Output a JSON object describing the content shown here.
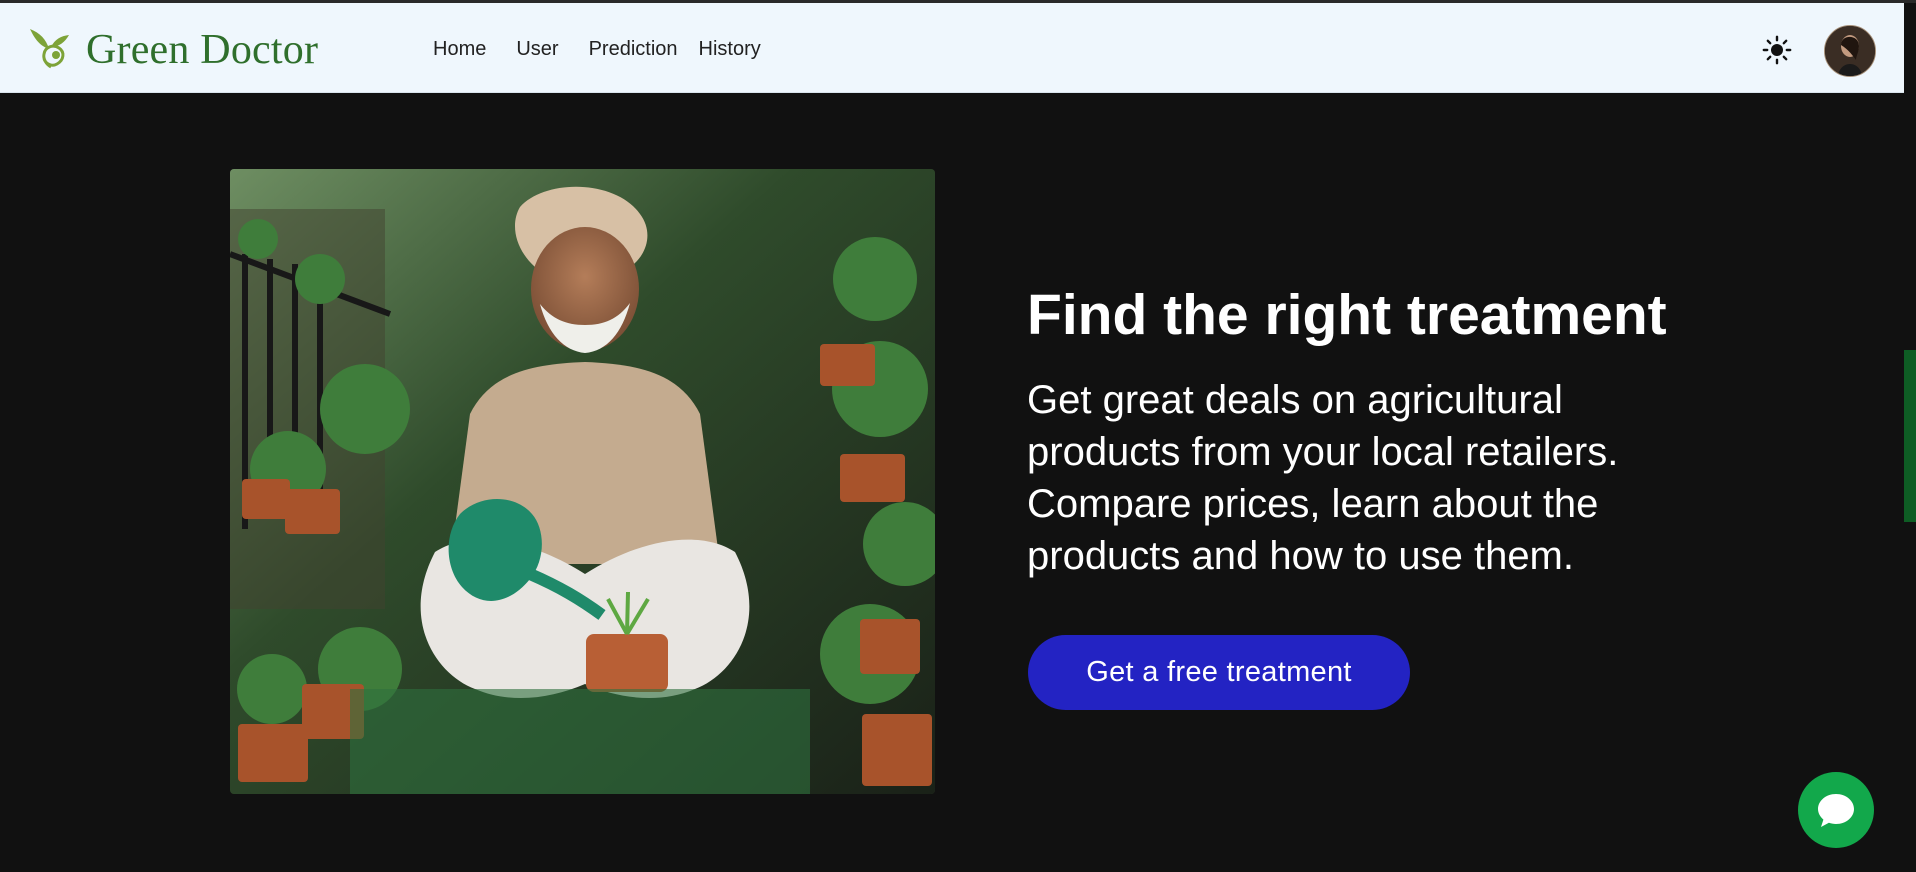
{
  "brand": {
    "name": "Green Doctor",
    "logo_icon": "sprout-icon",
    "brand_color": "#2f6f2c"
  },
  "nav": {
    "items": [
      "Home",
      "User",
      "Prediction",
      "History"
    ]
  },
  "header_actions": {
    "theme_icon": "sun-icon",
    "avatar_icon": "user-avatar"
  },
  "hero": {
    "title": "Find the right treatment",
    "description": "Get great deals on agricultural products from your local retailers. Compare prices, learn about the products and how to use them.",
    "cta_label": "Get a free treatment",
    "cta_color": "#2323c3",
    "image_icon": "farmer-with-plants-image"
  },
  "chat": {
    "icon": "chat-bubble-icon",
    "color": "#12a84b"
  },
  "theme": {
    "page_background": "#111111",
    "nav_background": "#eff7fd"
  }
}
